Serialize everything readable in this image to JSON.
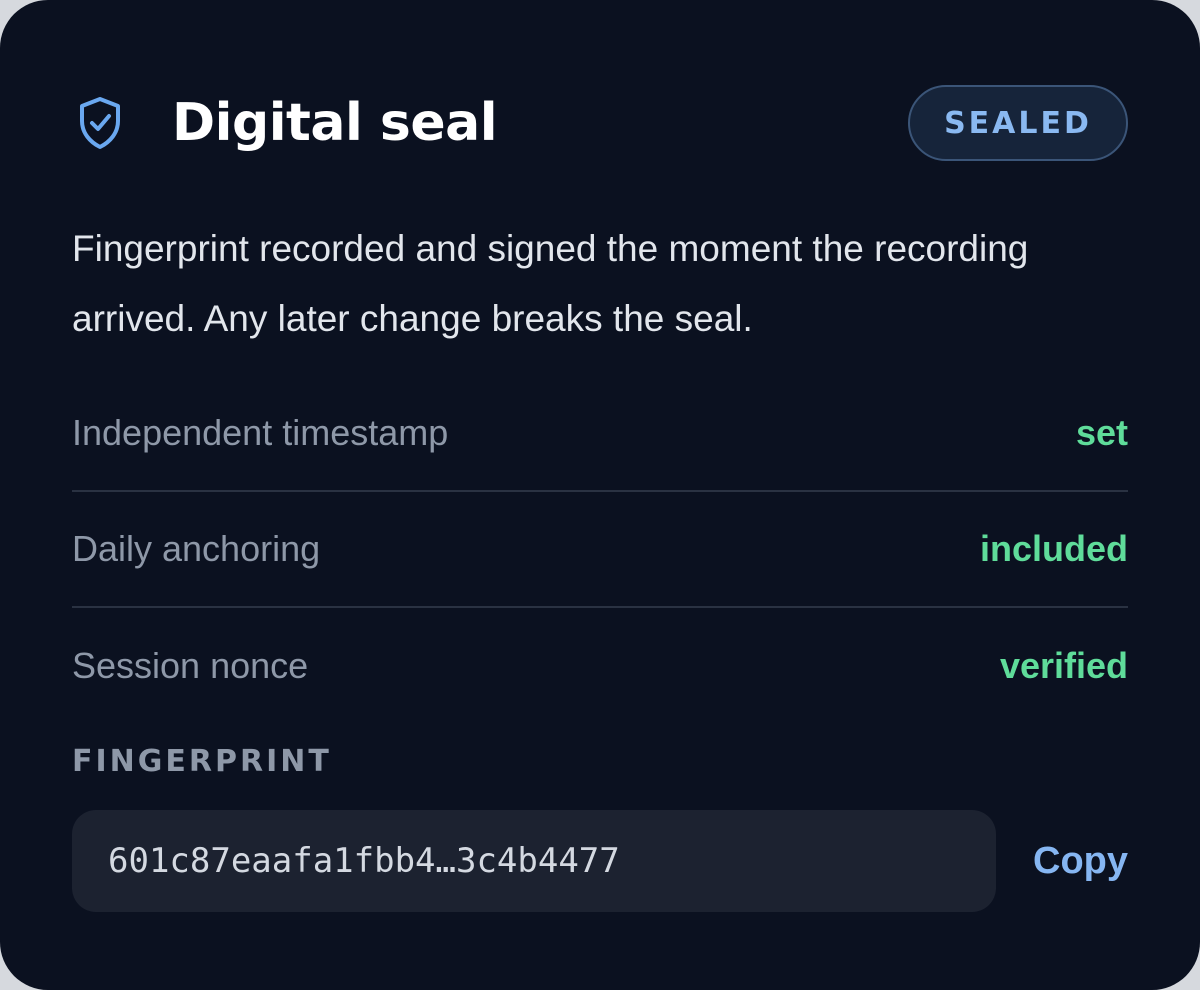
{
  "header": {
    "title": "Digital seal",
    "icon": "shield-check-icon",
    "badge": "SEALED"
  },
  "description": "Fingerprint recorded and signed the moment the recording arrived. Any later change breaks the seal.",
  "rows": [
    {
      "label": "Independent timestamp",
      "value": "set"
    },
    {
      "label": "Daily anchoring",
      "value": "included"
    },
    {
      "label": "Session nonce",
      "value": "verified"
    }
  ],
  "fingerprint": {
    "label": "FINGERPRINT",
    "value": "601c87eaafa1fbb4…3c4b4477",
    "copy_label": "Copy"
  },
  "colors": {
    "background": "#0b1120",
    "accent": "#86b6f2",
    "status_ok": "#5fdc9a"
  }
}
